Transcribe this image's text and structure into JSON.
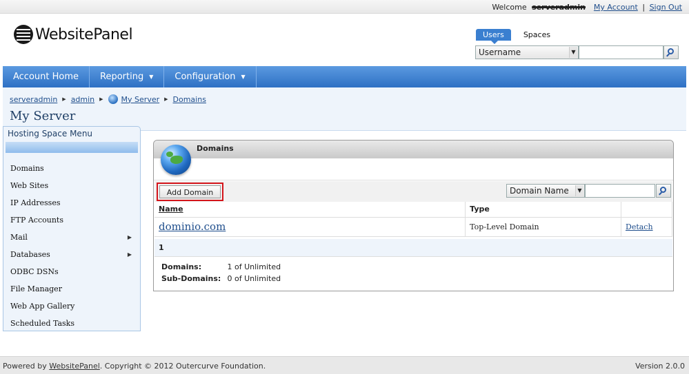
{
  "topbar": {
    "welcome": "Welcome",
    "username": "serveradmin",
    "my_account": "My Account",
    "separator": "|",
    "sign_out": "Sign Out"
  },
  "brand": {
    "logo_text": "WebsitePanel"
  },
  "search": {
    "tabs": [
      "Users",
      "Spaces"
    ],
    "field_selected": "Username",
    "value": ""
  },
  "nav": {
    "items": [
      {
        "label": "Account Home",
        "has_menu": false
      },
      {
        "label": "Reporting",
        "has_menu": true
      },
      {
        "label": "Configuration",
        "has_menu": true
      }
    ]
  },
  "breadcrumb": [
    "serveradmin",
    "admin",
    "My Server",
    "Domains"
  ],
  "page": {
    "title": "My Server"
  },
  "sidebar": {
    "header": "Hosting Space Menu",
    "items": [
      {
        "label": "Domains",
        "submenu": false
      },
      {
        "label": "Web Sites",
        "submenu": false
      },
      {
        "label": "IP Addresses",
        "submenu": false
      },
      {
        "label": "FTP Accounts",
        "submenu": false
      },
      {
        "label": "Mail",
        "submenu": true
      },
      {
        "label": "Databases",
        "submenu": true
      },
      {
        "label": "ODBC DSNs",
        "submenu": false
      },
      {
        "label": "File Manager",
        "submenu": false
      },
      {
        "label": "Web App Gallery",
        "submenu": false
      },
      {
        "label": "Scheduled Tasks",
        "submenu": false
      }
    ]
  },
  "panel": {
    "title": "Domains",
    "add_button": "Add Domain",
    "filter_field": "Domain Name",
    "filter_value": "",
    "columns": [
      "Name",
      "Type",
      ""
    ],
    "rows": [
      {
        "name": "dominio.com",
        "type": "Top-Level Domain",
        "action": "Detach"
      }
    ],
    "pager": "1",
    "stats": [
      {
        "label": "Domains:",
        "value": "1 of Unlimited"
      },
      {
        "label": "Sub-Domains:",
        "value": "0 of Unlimited"
      }
    ]
  },
  "footer": {
    "powered_by": "Powered by",
    "link": "WebsitePanel",
    "copyright": ". Copyright © 2012 Outercurve Foundation.",
    "version": "Version 2.0.0"
  },
  "colors": {
    "nav_blue": "#2e70c4",
    "highlight_red": "#d4141a",
    "link": "#1f4e8c"
  }
}
